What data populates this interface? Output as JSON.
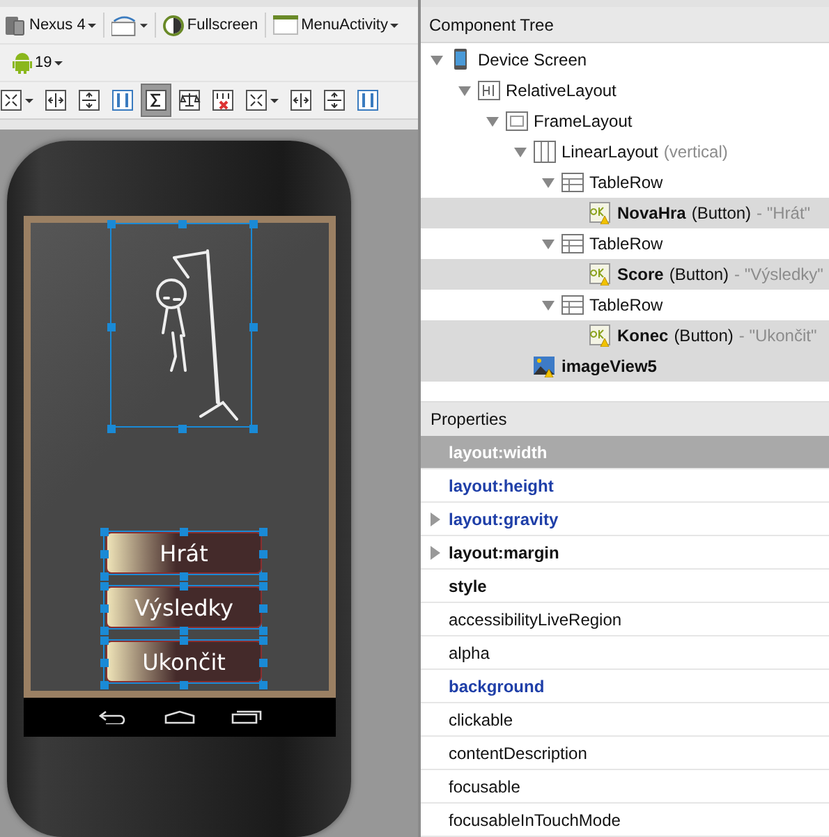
{
  "toolbar": {
    "device": "Nexus 4",
    "mode": "Fullscreen",
    "activity": "MenuActivity",
    "api": "19",
    "tools": [
      {
        "kind": "fit",
        "dropdown": true,
        "selected": false
      },
      {
        "kind": "spread-h",
        "dropdown": false,
        "selected": false
      },
      {
        "kind": "spread-v",
        "dropdown": false,
        "selected": false
      },
      {
        "kind": "columns",
        "dropdown": false,
        "selected": false
      },
      {
        "kind": "sigma",
        "dropdown": false,
        "selected": true
      },
      {
        "kind": "balance",
        "dropdown": false,
        "selected": false
      },
      {
        "kind": "remove",
        "dropdown": false,
        "selected": false
      },
      {
        "kind": "fit",
        "dropdown": true,
        "selected": false
      },
      {
        "kind": "spread-h",
        "dropdown": false,
        "selected": false
      },
      {
        "kind": "spread-v",
        "dropdown": false,
        "selected": false
      },
      {
        "kind": "columns",
        "dropdown": false,
        "selected": false
      }
    ]
  },
  "preview": {
    "buttons": [
      {
        "label": "Hrát"
      },
      {
        "label": "Výsledky"
      },
      {
        "label": "Ukončit"
      }
    ]
  },
  "component_tree": {
    "title": "Component Tree",
    "items": [
      {
        "name": "Device Screen",
        "kind": "device",
        "expanded": true,
        "selected": false,
        "children": [
          {
            "name": "RelativeLayout",
            "kind": "relative",
            "expanded": true,
            "selected": false,
            "children": [
              {
                "name": "FrameLayout",
                "kind": "frame",
                "expanded": true,
                "selected": false,
                "children": [
                  {
                    "name": "LinearLayout",
                    "note": "(vertical)",
                    "kind": "linear",
                    "expanded": true,
                    "selected": false,
                    "children": [
                      {
                        "name": "TableRow",
                        "kind": "tablerow",
                        "expanded": true,
                        "selected": false,
                        "children": [
                          {
                            "name": "NovaHra",
                            "type": "(Button)",
                            "text": "- \"Hrát\"",
                            "kind": "button",
                            "selected": true
                          }
                        ]
                      },
                      {
                        "name": "TableRow",
                        "kind": "tablerow",
                        "expanded": true,
                        "selected": false,
                        "children": [
                          {
                            "name": "Score",
                            "type": "(Button)",
                            "text": "- \"Výsledky\"",
                            "kind": "button",
                            "selected": true
                          }
                        ]
                      },
                      {
                        "name": "TableRow",
                        "kind": "tablerow",
                        "expanded": true,
                        "selected": false,
                        "children": [
                          {
                            "name": "Konec",
                            "type": "(Button)",
                            "text": "- \"Ukončit\"",
                            "kind": "button",
                            "selected": true
                          }
                        ]
                      }
                    ]
                  },
                  {
                    "name": "imageView5",
                    "kind": "image",
                    "selected": true
                  }
                ]
              }
            ]
          }
        ]
      }
    ]
  },
  "properties": {
    "title": "Properties",
    "rows": [
      {
        "name": "layout:width",
        "kind": "modified",
        "expandable": false,
        "selected": true
      },
      {
        "name": "layout:height",
        "kind": "modified",
        "expandable": false,
        "selected": false
      },
      {
        "name": "layout:gravity",
        "kind": "modified",
        "expandable": true,
        "selected": false
      },
      {
        "name": "layout:margin",
        "kind": "bold",
        "expandable": true,
        "selected": false
      },
      {
        "name": "style",
        "kind": "bold",
        "expandable": false,
        "selected": false
      },
      {
        "name": "accessibilityLiveRegion",
        "kind": "plain",
        "expandable": false,
        "selected": false
      },
      {
        "name": "alpha",
        "kind": "plain",
        "expandable": false,
        "selected": false
      },
      {
        "name": "background",
        "kind": "modified",
        "expandable": false,
        "selected": false
      },
      {
        "name": "clickable",
        "kind": "plain",
        "expandable": false,
        "selected": false
      },
      {
        "name": "contentDescription",
        "kind": "plain",
        "expandable": false,
        "selected": false
      },
      {
        "name": "focusable",
        "kind": "plain",
        "expandable": false,
        "selected": false
      },
      {
        "name": "focusableInTouchMode",
        "kind": "plain",
        "expandable": false,
        "selected": false
      }
    ]
  }
}
